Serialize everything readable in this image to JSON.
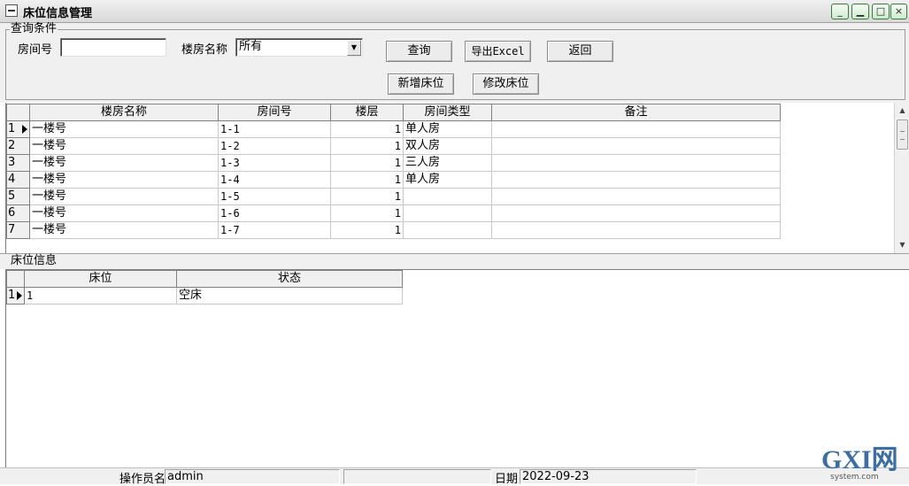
{
  "window": {
    "title": "床位信息管理",
    "controls": [
      "_",
      "□",
      "×"
    ]
  },
  "query": {
    "legend": "查询条件",
    "room_label": "房间号",
    "room_value": "",
    "building_label": "楼房名称",
    "building_value": "所有",
    "buttons": {
      "search": "查询",
      "export": "导出Excel",
      "back": "返回",
      "add": "新增床位",
      "edit": "修改床位"
    }
  },
  "rooms_table": {
    "columns": [
      "楼房名称",
      "房间号",
      "楼层",
      "房间类型",
      "备注"
    ],
    "rows": [
      {
        "index": "1",
        "building": "一楼号",
        "room": "1-1",
        "floor": "1",
        "type": "单人房",
        "note": ""
      },
      {
        "index": "2",
        "building": "一楼号",
        "room": "1-2",
        "floor": "1",
        "type": "双人房",
        "note": ""
      },
      {
        "index": "3",
        "building": "一楼号",
        "room": "1-3",
        "floor": "1",
        "type": "三人房",
        "note": ""
      },
      {
        "index": "4",
        "building": "一楼号",
        "room": "1-4",
        "floor": "1",
        "type": "单人房",
        "note": ""
      },
      {
        "index": "5",
        "building": "一楼号",
        "room": "1-5",
        "floor": "1",
        "type": "",
        "note": ""
      },
      {
        "index": "6",
        "building": "一楼号",
        "room": "1-6",
        "floor": "1",
        "type": "",
        "note": ""
      },
      {
        "index": "7",
        "building": "一楼号",
        "room": "1-7",
        "floor": "1",
        "type": "",
        "note": ""
      }
    ]
  },
  "bed_section": {
    "legend": "床位信息",
    "columns": [
      "床位",
      "状态"
    ],
    "rows": [
      {
        "index": "1",
        "bed": "1",
        "status": "空床"
      }
    ]
  },
  "statusbar": {
    "operator_label": "操作员名",
    "operator_value": "admin",
    "date_label": "日期",
    "date_value": "2022-09-23"
  },
  "watermark": {
    "text": "GXI网",
    "sub": "system.com"
  }
}
